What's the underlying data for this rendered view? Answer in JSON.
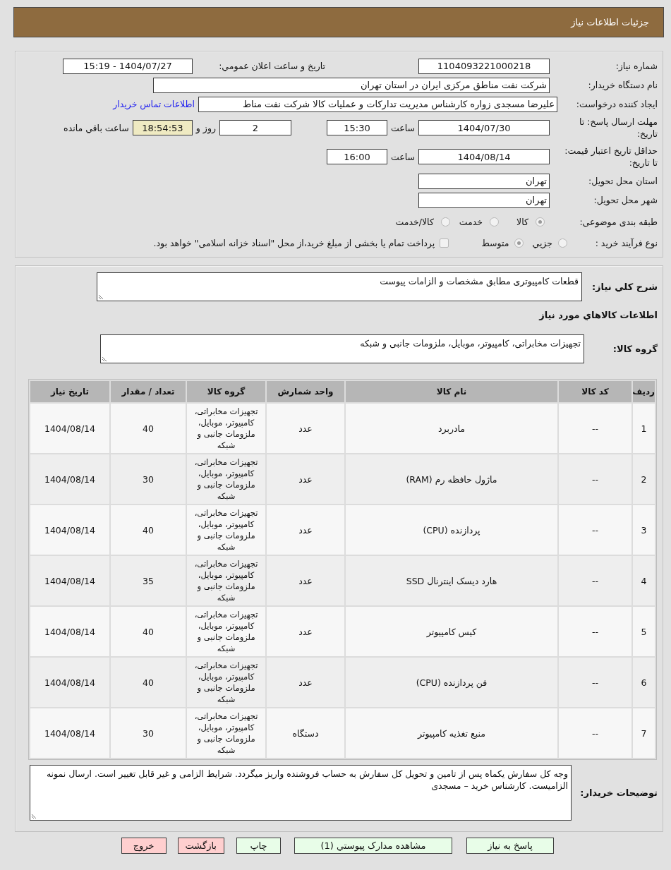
{
  "header": {
    "title": "جزئيات اطلاعات نياز"
  },
  "details": {
    "need_number": {
      "label": "شماره نياز:",
      "value": "1104093221000218"
    },
    "announce_date": {
      "label": "تاريخ و ساعت اعلان عمومي:",
      "value": "1404/07/27 - 15:19"
    },
    "buyer_org": {
      "label": "نام دستگاه خريدار:",
      "value": "شرکت نفت مناطق مرکزی ایران در استان تهران"
    },
    "requester": {
      "label": "ايجاد کننده درخواست:",
      "value": "علیرضا مسجدی زواره کارشناس مدیریت تدارکات و عملیات کالا شرکت نفت مناط",
      "link": "اطلاعات تماس خريدار"
    },
    "response_deadline": {
      "label": "مهلت ارسال پاسخ: تا تاريخ:",
      "date": "1404/07/30",
      "time_label": "ساعت",
      "time": "15:30",
      "days": "2",
      "days_label": "روز و",
      "remaining": "18:54:53",
      "remaining_label": "ساعت باقي مانده"
    },
    "price_validity": {
      "label": "حداقل تاريخ اعتبار قيمت: تا تاريخ:",
      "date": "1404/08/14",
      "time_label": "ساعت",
      "time": "16:00"
    },
    "delivery_province": {
      "label": "استان محل تحويل:",
      "value": "تهران"
    },
    "delivery_city": {
      "label": "شهر محل تحويل:",
      "value": "تهران"
    },
    "category": {
      "label": "طبقه بندی موضوعی:",
      "options": [
        {
          "label": "کالا",
          "selected": true
        },
        {
          "label": "خدمت",
          "selected": false
        },
        {
          "label": "کالا/خدمت",
          "selected": false
        }
      ]
    },
    "purchase_process": {
      "label": "نوع فرآیند خرید :",
      "options": [
        {
          "label": "جزيي",
          "selected": false
        },
        {
          "label": "متوسط",
          "selected": true
        }
      ],
      "treasury_payment": {
        "label": "پرداخت تمام یا بخشی از مبلغ خرید،از محل \"اسناد خزانه اسلامی\" خواهد بود.",
        "checked": false
      }
    }
  },
  "need": {
    "summary_label": "شرح کلي نياز:",
    "summary": "قطعات کامپیوتری مطابق مشخصات و الزامات پیوست",
    "goods_heading": "اطلاعات کالاهاي مورد نياز",
    "group_label": "گروه کالا:",
    "group": "تجهیزات مخابراتی، کامپیوتر، موبایل، ملزومات جانبی و شبکه"
  },
  "table": {
    "columns": [
      "رديف",
      "کد کالا",
      "نام کالا",
      "واحد شمارش",
      "گروه کالا",
      "تعداد / مقدار",
      "تاريخ نياز"
    ],
    "rows": [
      [
        "1",
        "--",
        "مادربرد",
        "عدد",
        "تجهیزات مخابراتی، کامپیوتر، موبایل، ملزومات جانبی و شبکه",
        "40",
        "1404/08/14"
      ],
      [
        "2",
        "--",
        "ماژول حافظه رم (RAM)",
        "عدد",
        "تجهیزات مخابراتی، کامپیوتر، موبایل، ملزومات جانبی و شبکه",
        "30",
        "1404/08/14"
      ],
      [
        "3",
        "--",
        "پردازنده (CPU)",
        "عدد",
        "تجهیزات مخابراتی، کامپیوتر، موبایل، ملزومات جانبی و شبکه",
        "40",
        "1404/08/14"
      ],
      [
        "4",
        "--",
        "هارد دیسک اینترنال SSD",
        "عدد",
        "تجهیزات مخابراتی، کامپیوتر، موبایل، ملزومات جانبی و شبکه",
        "35",
        "1404/08/14"
      ],
      [
        "5",
        "--",
        "کیس کامپیوتر",
        "عدد",
        "تجهیزات مخابراتی، کامپیوتر، موبایل، ملزومات جانبی و شبکه",
        "40",
        "1404/08/14"
      ],
      [
        "6",
        "--",
        "فن پردازنده (CPU)",
        "عدد",
        "تجهیزات مخابراتی، کامپیوتر، موبایل، ملزومات جانبی و شبکه",
        "40",
        "1404/08/14"
      ],
      [
        "7",
        "--",
        "منبع تغذیه کامپیوتر",
        "دستگاه",
        "تجهیزات مخابراتی، کامپیوتر، موبایل، ملزومات جانبی و شبکه",
        "30",
        "1404/08/14"
      ]
    ]
  },
  "buyer_notes": {
    "label": "توضيحات خريدار:",
    "text": "وجه کل سفارش یکماه پس از تامین و تحویل کل سفارش به حساب فروشنده واریز میگردد. شرایط الزامی و غیر قابل تغییر است. ارسال نمونه الزامیست. کارشناس خرید – مسجدی"
  },
  "buttons": [
    {
      "label": "پاسخ به نياز",
      "kind": "action"
    },
    {
      "label": "مشاهده مدارک پيوستي (1)",
      "kind": "action"
    },
    {
      "label": "چاپ",
      "kind": "action"
    },
    {
      "label": "بازگشت",
      "kind": "exit"
    },
    {
      "label": "خروج",
      "kind": "exit"
    }
  ]
}
